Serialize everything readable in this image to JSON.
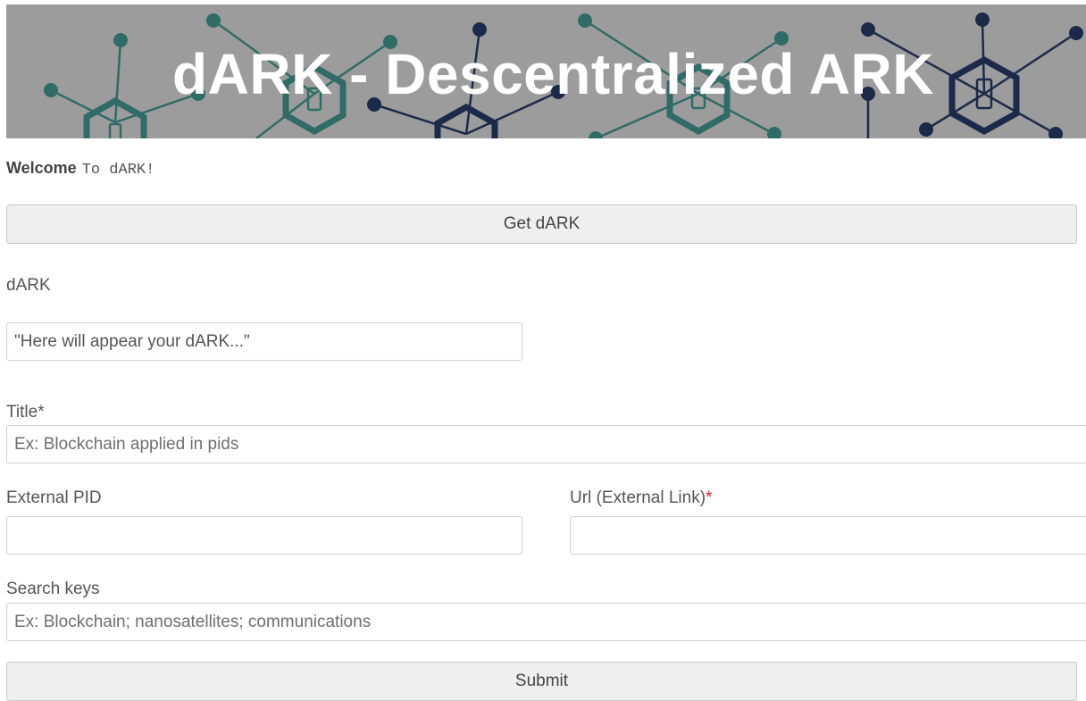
{
  "banner": {
    "title": "dARK - Descentralized ARK"
  },
  "welcome": {
    "bold": "Welcome",
    "text": "To dARK!"
  },
  "get_dark_button": "Get dARK",
  "dark_section": {
    "label": "dARK",
    "value": "\"Here will appear your dARK...\""
  },
  "form": {
    "title": {
      "label": "Title*",
      "placeholder": "Ex: Blockchain applied in pids"
    },
    "external_pid": {
      "label": "External PID",
      "value": ""
    },
    "url": {
      "label": "Url (External Link)",
      "required_mark": "*",
      "value": ""
    },
    "search_keys": {
      "label": "Search keys",
      "placeholder": "Ex: Blockchain; nanosatellites; communications"
    },
    "submit_label": "Submit"
  },
  "colors": {
    "banner_bg": "#9c9c9c",
    "node_teal": "#2f6b67",
    "node_navy": "#1c2a4a",
    "button_bg": "#efefef"
  }
}
